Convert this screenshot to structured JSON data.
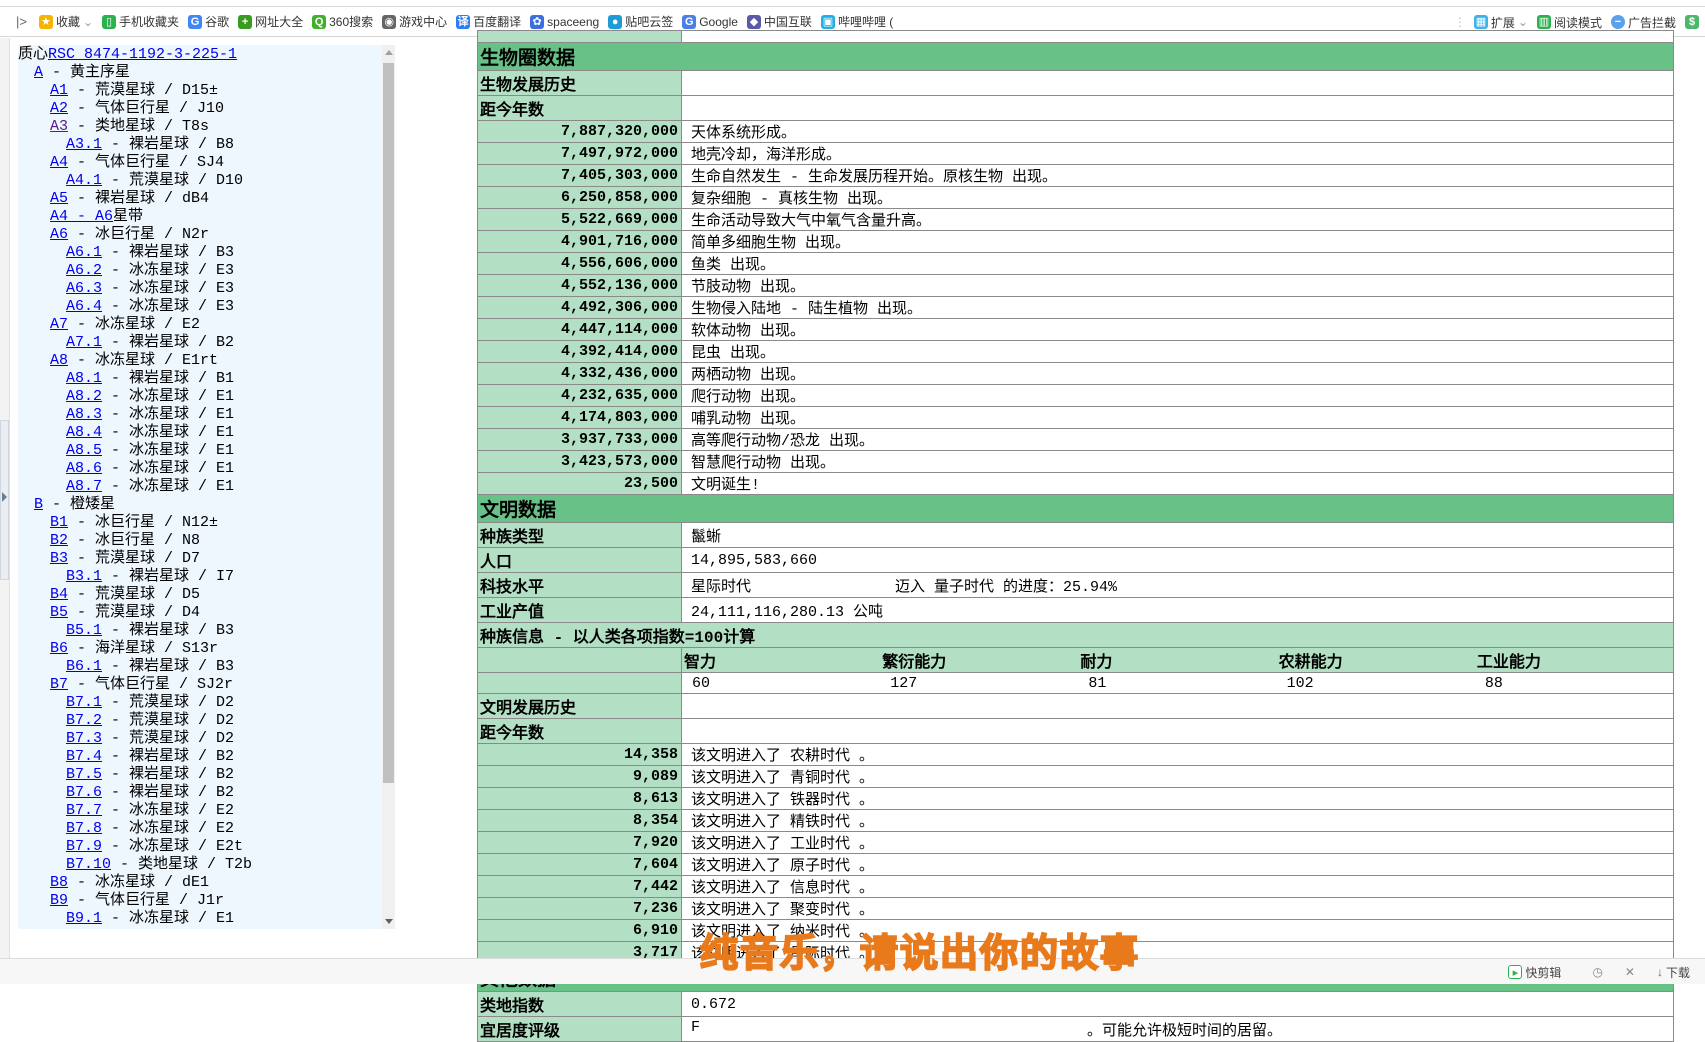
{
  "toolbar": {
    "items": [
      {
        "label": "收藏",
        "icon": "star-icon",
        "color": "#f5b400",
        "glyph": "★"
      },
      {
        "label": "手机收藏夹",
        "icon": "phone-icon",
        "color": "#2bb24c",
        "glyph": "▯"
      },
      {
        "label": "谷歌",
        "icon": "google-icon",
        "color": "#4285f4",
        "glyph": "G"
      },
      {
        "label": "网址大全",
        "icon": "plus-circle-icon",
        "color": "#3a9b1e",
        "glyph": "+"
      },
      {
        "label": "360搜索",
        "icon": "search-360-icon",
        "color": "#43b02a",
        "glyph": "Q"
      },
      {
        "label": "游戏中心",
        "icon": "gamepad-icon",
        "color": "#666666",
        "glyph": "◉"
      },
      {
        "label": "百度翻译",
        "icon": "translate-icon",
        "color": "#2f7cf6",
        "glyph": "译"
      },
      {
        "label": "spaceeng",
        "icon": "paw-icon",
        "color": "#3b6fe0",
        "glyph": "✿"
      },
      {
        "label": "贴吧云签",
        "icon": "cloud-icon",
        "color": "#1f9bd7",
        "glyph": "●"
      },
      {
        "label": "Google",
        "icon": "google-translate-icon",
        "color": "#4a7fe8",
        "glyph": "G"
      },
      {
        "label": "中国互联",
        "icon": "diamond-icon",
        "color": "#5a5aa8",
        "glyph": "◆"
      },
      {
        "label": "哔哩哔哩 (",
        "icon": "bilibili-icon",
        "color": "#23ade5",
        "glyph": "▣"
      }
    ],
    "right": {
      "extensions": "扩展",
      "reading_mode": "阅读模式",
      "ad_block": "广告拦截"
    }
  },
  "sidebar": {
    "tree": [
      {
        "level": 0,
        "prefix": "质心",
        "link": "RSC 8474-1192-3-225-1",
        "text": ""
      },
      {
        "level": 1,
        "link": "A",
        "text": " - 黄主序星"
      },
      {
        "level": 2,
        "link": "A1",
        "text": " - 荒漠星球 / D15±"
      },
      {
        "level": 2,
        "link": "A2",
        "text": " - 气体巨行星 / J10"
      },
      {
        "level": 2,
        "link": "A3",
        "text": " - 类地星球 / T8s",
        "visited": true
      },
      {
        "level": 3,
        "link": "A3.1",
        "text": " - 裸岩星球 / B8"
      },
      {
        "level": 2,
        "link": "A4",
        "text": " - 气体巨行星 / SJ4"
      },
      {
        "level": 3,
        "link": "A4.1",
        "text": " - 荒漠星球 / D10"
      },
      {
        "level": 2,
        "link": "A5",
        "text": " - 裸岩星球 / dB4"
      },
      {
        "level": 2,
        "link": "A4 - A6",
        "text": "星带"
      },
      {
        "level": 2,
        "link": "A6",
        "text": " - 冰巨行星 / N2r"
      },
      {
        "level": 3,
        "link": "A6.1",
        "text": " - 裸岩星球 / B3"
      },
      {
        "level": 3,
        "link": "A6.2",
        "text": " - 冰冻星球 / E3"
      },
      {
        "level": 3,
        "link": "A6.3",
        "text": " - 冰冻星球 / E3"
      },
      {
        "level": 3,
        "link": "A6.4",
        "text": " - 冰冻星球 / E3"
      },
      {
        "level": 2,
        "link": "A7",
        "text": " - 冰冻星球 / E2"
      },
      {
        "level": 3,
        "link": "A7.1",
        "text": " - 裸岩星球 / B2"
      },
      {
        "level": 2,
        "link": "A8",
        "text": " - 冰冻星球 / E1rt"
      },
      {
        "level": 3,
        "link": "A8.1",
        "text": " - 裸岩星球 / B1"
      },
      {
        "level": 3,
        "link": "A8.2",
        "text": " - 冰冻星球 / E1"
      },
      {
        "level": 3,
        "link": "A8.3",
        "text": " - 冰冻星球 / E1"
      },
      {
        "level": 3,
        "link": "A8.4",
        "text": " - 冰冻星球 / E1"
      },
      {
        "level": 3,
        "link": "A8.5",
        "text": " - 冰冻星球 / E1"
      },
      {
        "level": 3,
        "link": "A8.6",
        "text": " - 冰冻星球 / E1"
      },
      {
        "level": 3,
        "link": "A8.7",
        "text": " - 冰冻星球 / E1"
      },
      {
        "level": 1,
        "link": "B",
        "text": " - 橙矮星"
      },
      {
        "level": 2,
        "link": "B1",
        "text": " - 冰巨行星 / N12±"
      },
      {
        "level": 2,
        "link": "B2",
        "text": " - 冰巨行星 / N8"
      },
      {
        "level": 2,
        "link": "B3",
        "text": " - 荒漠星球 / D7"
      },
      {
        "level": 3,
        "link": "B3.1",
        "text": " - 裸岩星球 / I7"
      },
      {
        "level": 2,
        "link": "B4",
        "text": " - 荒漠星球 / D5"
      },
      {
        "level": 2,
        "link": "B5",
        "text": " - 荒漠星球 / D4"
      },
      {
        "level": 3,
        "link": "B5.1",
        "text": " - 裸岩星球 / B3"
      },
      {
        "level": 2,
        "link": "B6",
        "text": " - 海洋星球 / S13r"
      },
      {
        "level": 3,
        "link": "B6.1",
        "text": " - 裸岩星球 / B3"
      },
      {
        "level": 2,
        "link": "B7",
        "text": " - 气体巨行星 / SJ2r"
      },
      {
        "level": 3,
        "link": "B7.1",
        "text": " - 荒漠星球 / D2"
      },
      {
        "level": 3,
        "link": "B7.2",
        "text": " - 荒漠星球 / D2"
      },
      {
        "level": 3,
        "link": "B7.3",
        "text": " - 荒漠星球 / D2"
      },
      {
        "level": 3,
        "link": "B7.4",
        "text": " - 裸岩星球 / B2"
      },
      {
        "level": 3,
        "link": "B7.5",
        "text": " - 裸岩星球 / B2"
      },
      {
        "level": 3,
        "link": "B7.6",
        "text": " - 裸岩星球 / B2"
      },
      {
        "level": 3,
        "link": "B7.7",
        "text": " - 冰冻星球 / E2"
      },
      {
        "level": 3,
        "link": "B7.8",
        "text": " - 冰冻星球 / E2"
      },
      {
        "level": 3,
        "link": "B7.9",
        "text": " - 冰冻星球 / E2t"
      },
      {
        "level": 3,
        "link": "B7.10",
        "text": " - 类地星球 / T2b"
      },
      {
        "level": 2,
        "link": "B8",
        "text": " - 冰冻星球 / dE1"
      },
      {
        "level": 2,
        "link": "B9",
        "text": " - 气体巨行星 / J1r"
      },
      {
        "level": 3,
        "link": "B9.1",
        "text": " - 冰冻星球 / E1"
      }
    ]
  },
  "biosphere": {
    "title": "生物圈数据",
    "history_label": "生物发展历史",
    "years_label": "距今年数",
    "events": [
      {
        "years": "7,887,320,000",
        "text": "天体系统形成。"
      },
      {
        "years": "7,497,972,000",
        "text": "地壳冷却，海洋形成。"
      },
      {
        "years": "7,405,303,000",
        "text": "生命自然发生 - 生命发展历程开始。原核生物 出现。"
      },
      {
        "years": "6,250,858,000",
        "text": "复杂细胞 - 真核生物 出现。"
      },
      {
        "years": "5,522,669,000",
        "text": "生命活动导致大气中氧气含量升高。"
      },
      {
        "years": "4,901,716,000",
        "text": "简单多细胞生物 出现。"
      },
      {
        "years": "4,556,606,000",
        "text": "鱼类 出现。"
      },
      {
        "years": "4,552,136,000",
        "text": "节肢动物 出现。"
      },
      {
        "years": "4,492,306,000",
        "text": "生物侵入陆地 - 陆生植物 出现。"
      },
      {
        "years": "4,447,114,000",
        "text": "软体动物 出现。"
      },
      {
        "years": "4,392,414,000",
        "text": "昆虫 出现。"
      },
      {
        "years": "4,332,436,000",
        "text": "两栖动物 出现。"
      },
      {
        "years": "4,232,635,000",
        "text": "爬行动物 出现。"
      },
      {
        "years": "4,174,803,000",
        "text": "哺乳动物 出现。"
      },
      {
        "years": "3,937,733,000",
        "text": "高等爬行动物/恐龙 出现。"
      },
      {
        "years": "3,423,573,000",
        "text": "智慧爬行动物 出现。"
      },
      {
        "years": "23,500",
        "text": "文明诞生!"
      }
    ]
  },
  "civilization": {
    "title": "文明数据",
    "species_label": "种族类型",
    "species": "鬣蜥",
    "population_label": "人口",
    "population": "14,895,583,660",
    "tech_label": "科技水平",
    "tech": "星际时代",
    "tech_progress": "迈入 量子时代 的进度：25.94%",
    "industry_label": "工业产值",
    "industry": "24,111,116,280.13 公吨",
    "species_info_label": "种族信息 - 以人类各项指数=100计算",
    "attributes": [
      {
        "name": "智力",
        "value": "60"
      },
      {
        "name": "繁衍能力",
        "value": "127"
      },
      {
        "name": "耐力",
        "value": "81"
      },
      {
        "name": "农耕能力",
        "value": "102"
      },
      {
        "name": "工业能力",
        "value": "88"
      }
    ],
    "history_label": "文明发展历史",
    "years_label": "距今年数",
    "events": [
      {
        "years": "14,358",
        "text": "该文明进入了 农耕时代 。"
      },
      {
        "years": "9,089",
        "text": "该文明进入了 青铜时代 。"
      },
      {
        "years": "8,613",
        "text": "该文明进入了 铁器时代 。"
      },
      {
        "years": "8,354",
        "text": "该文明进入了 精铁时代 。"
      },
      {
        "years": "7,920",
        "text": "该文明进入了 工业时代 。"
      },
      {
        "years": "7,604",
        "text": "该文明进入了 原子时代 。"
      },
      {
        "years": "7,442",
        "text": "该文明进入了 信息时代 。"
      },
      {
        "years": "7,236",
        "text": "该文明进入了 聚变时代 。"
      },
      {
        "years": "6,910",
        "text": "该文明进入了 纳米时代 。"
      },
      {
        "years": "3,717",
        "text": "该文明进入了 星际时代 。"
      }
    ]
  },
  "other": {
    "title": "其他数据",
    "earthlike_label": "类地指数",
    "earthlike": "0.672",
    "habitability_label": "宜居度评级",
    "habitability_grade": "F",
    "habitability_tail": "。可能允许极短时间的居留。"
  },
  "status_bar": {
    "quick_edit": "快剪辑",
    "download": "下载"
  },
  "overlay_caption": "纯音乐，请说出你的故事",
  "colors": {
    "section_header": "#68c186",
    "label_cell": "#b3e0c4",
    "link": "#0000ee",
    "sidebar_bg": "#eef6fe"
  }
}
